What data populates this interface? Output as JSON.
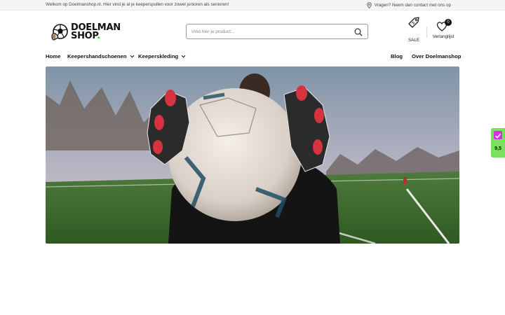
{
  "topbar": {
    "welcome": "Welkom op Doelmanshop.nl. Hier vind je al je keeperspullen voor zowel junioren als senioren!",
    "contact": "Vragen? Neem dan contact met ons op"
  },
  "logo": {
    "line1": "DOELMAN",
    "line2": "SHOP",
    "line2_dot": "."
  },
  "search": {
    "placeholder": "Vind hier je product..."
  },
  "header_actions": {
    "sale_label": "SALE",
    "wishlist_label": "Verlanglijst",
    "wishlist_count": "0"
  },
  "nav": {
    "items": [
      {
        "label": "Home"
      },
      {
        "label": "Keepershandschoenen"
      },
      {
        "label": "Keeperskleding"
      },
      {
        "label": "Blog"
      },
      {
        "label": "Over Doelmanshop"
      }
    ]
  },
  "rating_widget": {
    "score": "9,5"
  },
  "icons": {
    "contact": "map-pin-icon",
    "search": "search-icon",
    "sale": "price-tag-icon",
    "wishlist": "heart-icon",
    "dropdown": "chevron-down-icon",
    "rating": "checkmark-icon"
  },
  "colors": {
    "brand_green": "#2ec41f",
    "rating_bg": "#7be05f",
    "rating_check": "#d62fe3",
    "topbar_bg": "#f5f5f5"
  }
}
